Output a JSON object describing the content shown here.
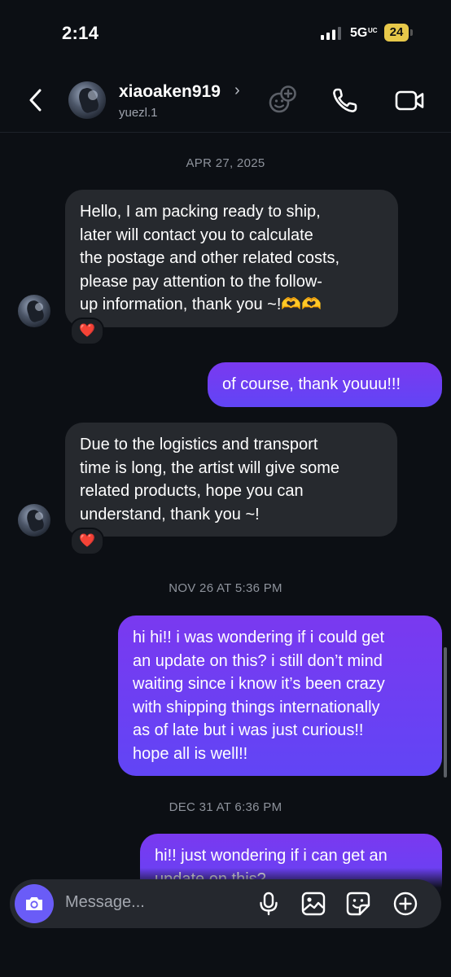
{
  "status_bar": {
    "time": "2:14",
    "network": "5G",
    "network_sub": "UC",
    "battery": "24"
  },
  "header": {
    "contact_name": "xiaoaken919",
    "chevron": "›",
    "handle": "yuezl.1",
    "icons": [
      "back-chevron-icon",
      "add-people-icon",
      "phone-icon",
      "video-camera-icon"
    ]
  },
  "conversation": {
    "date_separators": [
      "APR 27, 2025",
      "NOV 26 AT 5:36 PM",
      "DEC 31 AT 6:36 PM"
    ],
    "messages": [
      {
        "direction": "incoming",
        "text": "Hello, I am packing ready to ship,\nlater will contact you to calculate\nthe postage and other related costs,\nplease pay attention to the follow-\nup information, thank you ~!🫶🫶",
        "reaction": "❤️"
      },
      {
        "direction": "outgoing",
        "text": "of course, thank youuu!!!"
      },
      {
        "direction": "incoming",
        "text": "Due to the logistics and transport\ntime is long, the artist will give some\nrelated products, hope you can\nunderstand, thank you ~!",
        "reaction": "❤️"
      },
      {
        "direction": "outgoing",
        "text": "hi hi!! i was wondering if i could get\nan update on this? i still don’t mind\nwaiting since i know it’s been crazy\nwith shipping things internationally\nas of late but i was just curious!!\nhope all is well!!"
      },
      {
        "direction": "outgoing",
        "text": "hi!! just wondering if i can get an\nupdate on this?"
      }
    ]
  },
  "composer": {
    "placeholder": "Message...",
    "icons": [
      "camera-icon",
      "microphone-icon",
      "gallery-icon",
      "sticker-icon",
      "add-circle-icon"
    ]
  },
  "colors": {
    "background": "#0c0f14",
    "incoming_bubble": "#26292e",
    "outgoing_bubble_top": "#7a39f0",
    "outgoing_bubble_bottom": "#6145f5",
    "camera_button": "#6a5cf7",
    "battery": "#e7c84a"
  }
}
